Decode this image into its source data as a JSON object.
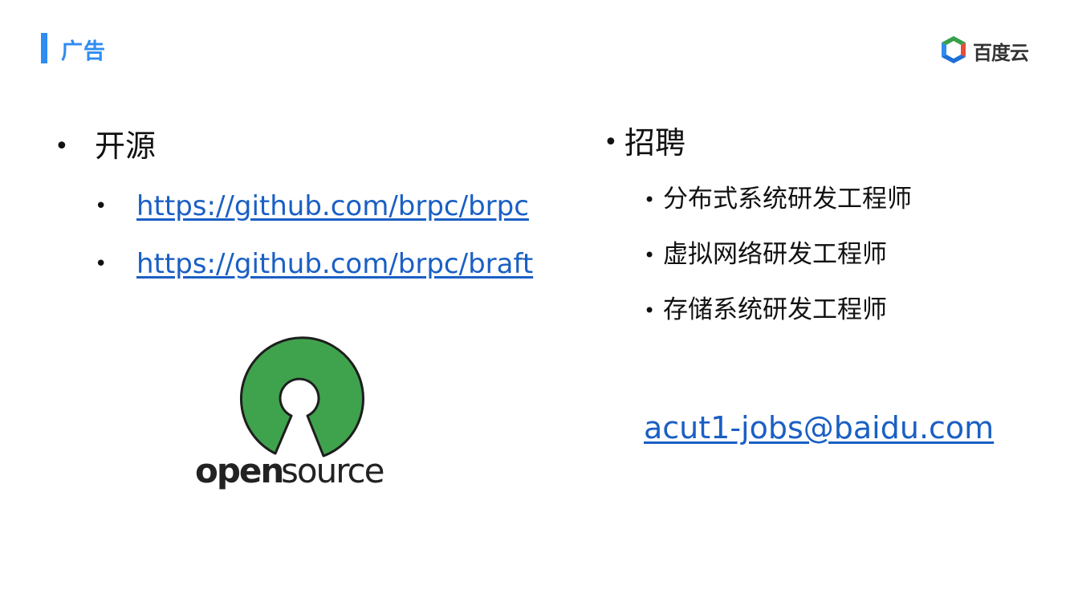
{
  "header": {
    "title": "广告",
    "brand_name": "百度云",
    "accent_color": "#2f8cf0"
  },
  "left": {
    "heading": "开源",
    "links": [
      "https://github.com/brpc/brpc",
      "https://github.com/brpc/braft"
    ],
    "logo": {
      "icon": "open-source-keyhole-icon",
      "text_1": "open",
      "text_2": "source",
      "color": "#3fa34d"
    }
  },
  "right": {
    "heading": "招聘",
    "jobs": [
      "分布式系统研发工程师",
      "虚拟网络研发工程师",
      "存储系统研发工程师"
    ],
    "email": "acut1-jobs@baidu.com"
  },
  "colors": {
    "link": "#1a5fc4",
    "text": "#111111"
  }
}
